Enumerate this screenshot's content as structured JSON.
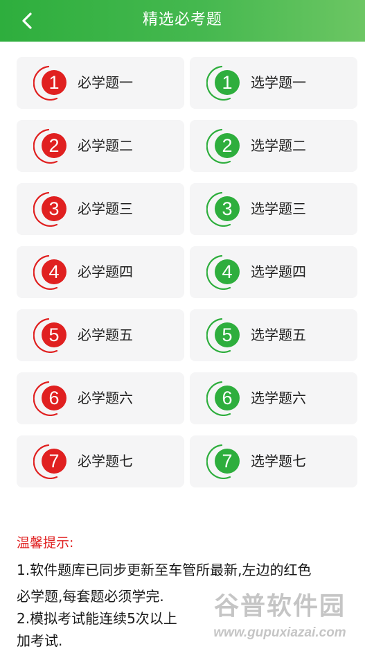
{
  "header": {
    "title": "精选必考题",
    "back_icon": "chevron-left-icon",
    "color_start": "#2eae3d",
    "color_end": "#6cc663"
  },
  "colors": {
    "required_badge": "#e02020",
    "optional_badge": "#2eae3d",
    "tip_title": "#e02020"
  },
  "required": [
    {
      "number": "1",
      "label": "必学题一"
    },
    {
      "number": "2",
      "label": "必学题二"
    },
    {
      "number": "3",
      "label": "必学题三"
    },
    {
      "number": "4",
      "label": "必学题四"
    },
    {
      "number": "5",
      "label": "必学题五"
    },
    {
      "number": "6",
      "label": "必学题六"
    },
    {
      "number": "7",
      "label": "必学题七"
    }
  ],
  "optional": [
    {
      "number": "1",
      "label": "选学题一"
    },
    {
      "number": "2",
      "label": "选学题二"
    },
    {
      "number": "3",
      "label": "选学题三"
    },
    {
      "number": "4",
      "label": "选学题四"
    },
    {
      "number": "5",
      "label": "选学题五"
    },
    {
      "number": "6",
      "label": "选学题六"
    },
    {
      "number": "7",
      "label": "选学题七"
    }
  ],
  "tips": {
    "title": "温馨提示:",
    "lines": [
      "1.软件题库已同步更新至车管所最新,左边的红色",
      "必学题,每套题必须学完.",
      "2.模拟考试能连续5次以上",
      "加考试."
    ]
  },
  "watermark": {
    "name": "谷普软件园",
    "url": "www.gupuxiazai.com"
  }
}
